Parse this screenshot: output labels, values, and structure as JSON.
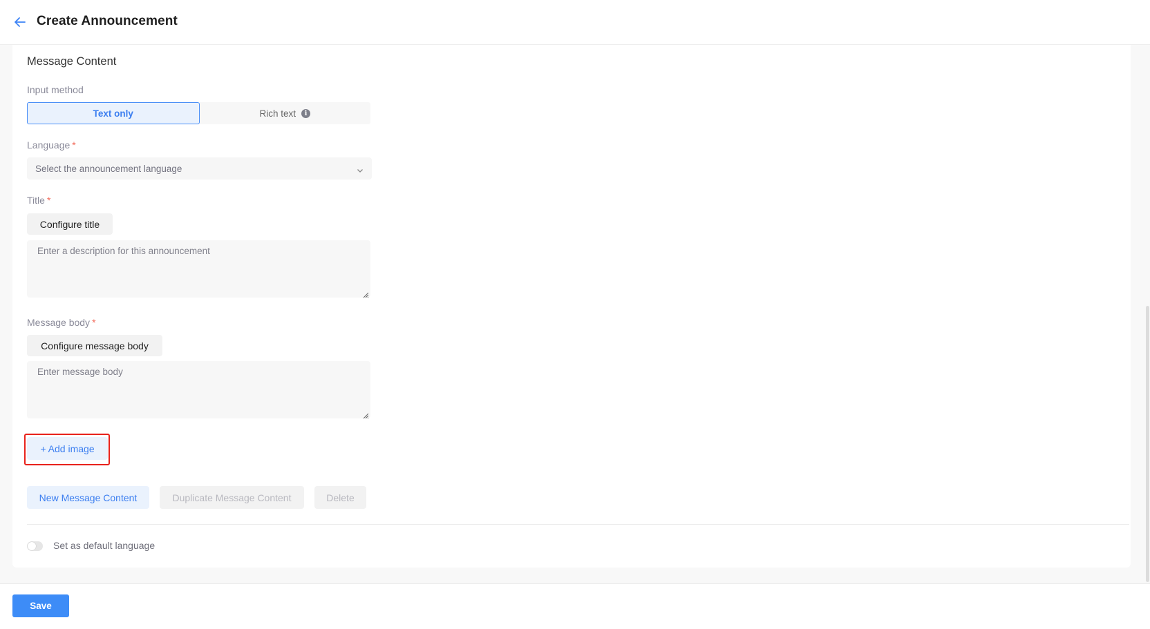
{
  "header": {
    "back_icon": "arrow-left-icon",
    "title": "Create Announcement"
  },
  "section": {
    "title": "Message Content"
  },
  "input_method": {
    "label": "Input method",
    "options": [
      {
        "label": "Text only",
        "selected": true
      },
      {
        "label": "Rich text",
        "selected": false,
        "icon": "info-icon"
      }
    ]
  },
  "language": {
    "label": "Language",
    "required_mark": "*",
    "placeholder": "Select the announcement language",
    "icon": "chevron-down-icon"
  },
  "title_field": {
    "label": "Title",
    "required_mark": "*",
    "configure_button": "Configure title",
    "placeholder": "Enter a description for this announcement",
    "value": ""
  },
  "message_body": {
    "label": "Message body",
    "required_mark": "*",
    "configure_button": "Configure message body",
    "placeholder": "Enter message body",
    "value": ""
  },
  "add_image": {
    "label": "+ Add image",
    "highlighted": true,
    "highlight_color": "#e8221b"
  },
  "actions": {
    "new_label": "New Message Content",
    "duplicate_label": "Duplicate Message Content",
    "delete_label": "Delete"
  },
  "default_language": {
    "label": "Set as default language",
    "enabled": false
  },
  "footer": {
    "save_label": "Save"
  },
  "colors": {
    "accent": "#3d8cf7",
    "accent_light": "#eaf2fd",
    "required": "#f26b5b",
    "page_bg": "#f8f8f8"
  }
}
